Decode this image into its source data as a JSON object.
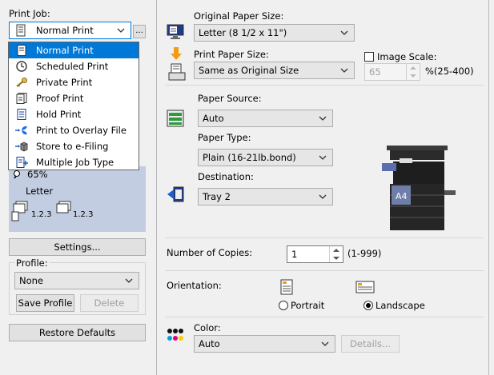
{
  "left": {
    "print_job_label": "Print Job:",
    "print_job_value": "Normal Print",
    "more_button": "...",
    "print_job_options": [
      {
        "label": "Normal Print",
        "icon": "normal-print-icon",
        "selected": true
      },
      {
        "label": "Scheduled Print",
        "icon": "clock-icon",
        "selected": false
      },
      {
        "label": "Private Print",
        "icon": "key-icon",
        "selected": false
      },
      {
        "label": "Proof Print",
        "icon": "proof-document-icon",
        "selected": false
      },
      {
        "label": "Hold Print",
        "icon": "hold-document-icon",
        "selected": false
      },
      {
        "label": "Print to Overlay File",
        "icon": "butterfly-icon",
        "selected": false
      },
      {
        "label": "Store to e-Filing",
        "icon": "box-icon",
        "selected": false
      },
      {
        "label": "Multiple Job Type",
        "icon": "multiple-job-icon",
        "selected": false
      }
    ],
    "preview": {
      "zoom": "65%",
      "paper": "Letter",
      "collate_a": "1.2.3",
      "collate_b": "1.2.3"
    },
    "settings_button": "Settings...",
    "profile_label": "Profile:",
    "profile_value": "None",
    "save_profile": "Save Profile",
    "delete_button": "Delete",
    "restore_defaults": "Restore Defaults"
  },
  "right": {
    "original_paper_size_label": "Original Paper Size:",
    "original_paper_size_value": "Letter (8 1/2 x 11\")",
    "print_paper_size_label": "Print Paper Size:",
    "print_paper_size_value": "Same as Original Size",
    "image_scale_label": "Image Scale:",
    "image_scale_value": "65",
    "image_scale_range": "%(25-400)",
    "paper_source_label": "Paper Source:",
    "paper_source_value": "Auto",
    "paper_type_label": "Paper Type:",
    "paper_type_value": "Plain (16-21lb.bond)",
    "destination_label": "Destination:",
    "destination_value": "Tray 2",
    "printer_paper_label": "A4",
    "copies_label": "Number of Copies:",
    "copies_value": "1",
    "copies_range": "(1-999)",
    "orientation_label": "Orientation:",
    "portrait": "Portrait",
    "landscape": "Landscape",
    "orientation_selected": "Landscape",
    "color_label": "Color:",
    "color_value": "Auto",
    "details_button": "Details..."
  },
  "colors": {
    "selection": "#0078d7",
    "preview_bg": "#c3cde1"
  }
}
